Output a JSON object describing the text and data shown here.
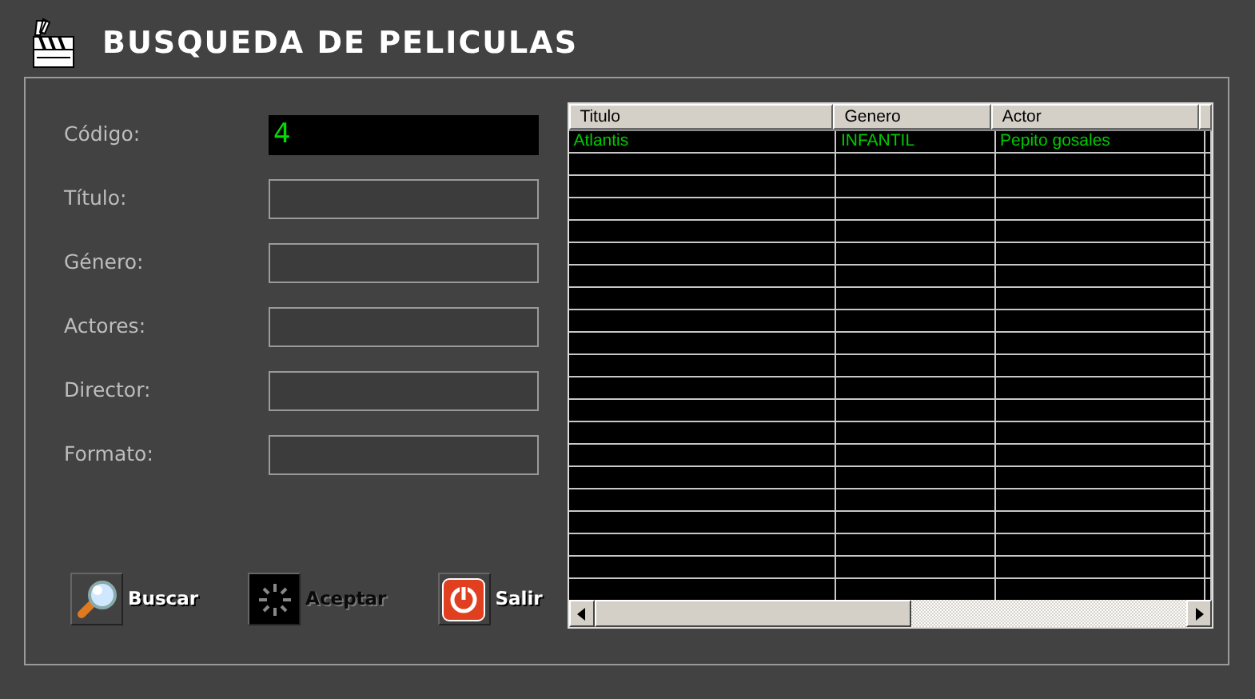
{
  "window": {
    "title": "BUSQUEDA DE PELICULAS"
  },
  "form": {
    "fields": [
      {
        "label": "Código:",
        "value": "4",
        "focused": true
      },
      {
        "label": "Título:",
        "focused": false
      },
      {
        "label": "Género:",
        "focused": false
      },
      {
        "label": "Actores:",
        "focused": false
      },
      {
        "label": "Director:",
        "focused": false
      },
      {
        "label": "Formato:",
        "focused": false
      }
    ]
  },
  "buttons": [
    {
      "label": "Buscar",
      "kind": "search",
      "disabled": false
    },
    {
      "label": "Aceptar",
      "kind": "accept",
      "disabled": true
    },
    {
      "label": "Salir",
      "kind": "exit",
      "disabled": false
    }
  ],
  "table": {
    "columns": [
      "Titulo",
      "Genero",
      "Actor"
    ],
    "rows": [
      [
        "Atlantis",
        "INFANTIL",
        "Pepito gosales"
      ]
    ]
  }
}
